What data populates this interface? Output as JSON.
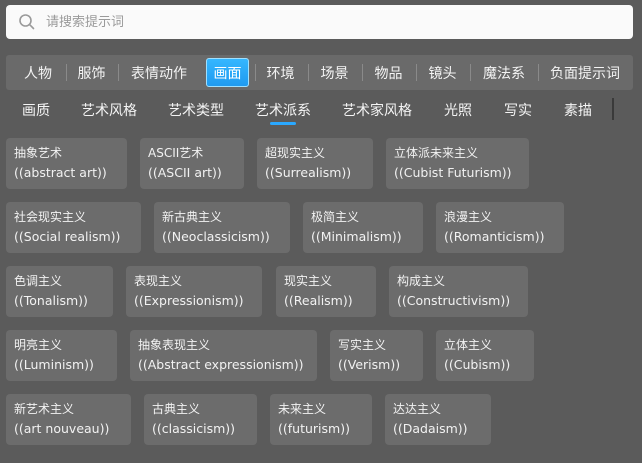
{
  "search": {
    "placeholder": "请搜索提示词"
  },
  "top_tabs": [
    "人物",
    "服饰",
    "表情动作",
    "画面",
    "环境",
    "场景",
    "物品",
    "镜头",
    "魔法系",
    "负面提示词"
  ],
  "active_top_tab": "画面",
  "sub_tabs": [
    "画质",
    "艺术风格",
    "艺术类型",
    "艺术派系",
    "艺术家风格",
    "光照",
    "写实",
    "素描"
  ],
  "active_sub_tab": "艺术派系",
  "accent_color": "#1f9af0",
  "cards": [
    {
      "cn": "抽象艺术",
      "en": "((abstract art))"
    },
    {
      "cn": "ASCII艺术",
      "en": "((ASCII art))"
    },
    {
      "cn": "超现实主义",
      "en": "((Surrealism))"
    },
    {
      "cn": "立体派未来主义",
      "en": "((Cubist Futurism))"
    },
    {
      "cn": "社会现实主义",
      "en": "((Social realism))"
    },
    {
      "cn": "新古典主义",
      "en": "((Neoclassicism))"
    },
    {
      "cn": "极简主义",
      "en": "((Minimalism))"
    },
    {
      "cn": "浪漫主义",
      "en": "((Romanticism))"
    },
    {
      "cn": "色调主义",
      "en": "((Tonalism))"
    },
    {
      "cn": "表现主义",
      "en": "((Expressionism))"
    },
    {
      "cn": "现实主义",
      "en": "((Realism))"
    },
    {
      "cn": "构成主义",
      "en": "((Constructivism))"
    },
    {
      "cn": "明亮主义",
      "en": "((Luminism))"
    },
    {
      "cn": "抽象表现主义",
      "en": "((Abstract expressionism))"
    },
    {
      "cn": "写实主义",
      "en": "((Verism))"
    },
    {
      "cn": "立体主义",
      "en": "((Cubism))"
    },
    {
      "cn": "新艺术主义",
      "en": "((art nouveau))"
    },
    {
      "cn": "古典主义",
      "en": "((classicism))"
    },
    {
      "cn": "未来主义",
      "en": "((futurism))"
    },
    {
      "cn": "达达主义",
      "en": "((Dadaism))"
    }
  ]
}
